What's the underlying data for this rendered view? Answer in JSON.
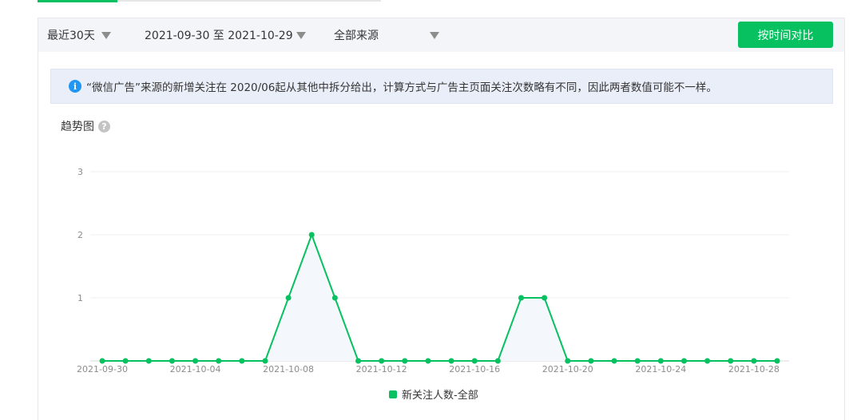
{
  "filters": {
    "period": "最近30天",
    "date_range": "2021-09-30 至 2021-10-29",
    "source": "全部来源",
    "compare_button": "按时间对比"
  },
  "notice": {
    "text": "“微信广告”来源的新增关注在 2020/06起从其他中拆分给出，计算方式与广告主页面关注次数略有不同，因此两者数值可能不一样。"
  },
  "trend": {
    "title": "趋势图",
    "help": "?"
  },
  "colors": {
    "accent": "#07c160",
    "info": "#2196f3"
  },
  "chart_data": {
    "type": "line",
    "x": [
      "2021-09-30",
      "2021-10-01",
      "2021-10-02",
      "2021-10-03",
      "2021-10-04",
      "2021-10-05",
      "2021-10-06",
      "2021-10-07",
      "2021-10-08",
      "2021-10-09",
      "2021-10-10",
      "2021-10-11",
      "2021-10-12",
      "2021-10-13",
      "2021-10-14",
      "2021-10-15",
      "2021-10-16",
      "2021-10-17",
      "2021-10-18",
      "2021-10-19",
      "2021-10-20",
      "2021-10-21",
      "2021-10-22",
      "2021-10-23",
      "2021-10-24",
      "2021-10-25",
      "2021-10-26",
      "2021-10-27",
      "2021-10-28",
      "2021-10-29"
    ],
    "x_tick_labels": [
      "2021-09-30",
      "2021-10-04",
      "2021-10-08",
      "2021-10-12",
      "2021-10-16",
      "2021-10-20",
      "2021-10-24",
      "2021-10-28"
    ],
    "y_ticks": [
      1,
      2,
      3
    ],
    "ylim": [
      0,
      3
    ],
    "series": [
      {
        "name": "新关注人数-全部",
        "values": [
          0,
          0,
          0,
          0,
          0,
          0,
          0,
          0,
          1,
          2,
          1,
          0,
          0,
          0,
          0,
          0,
          0,
          0,
          1,
          1,
          0,
          0,
          0,
          0,
          0,
          0,
          0,
          0,
          0,
          0
        ]
      }
    ],
    "grid": true,
    "legend": "bottom-center"
  }
}
